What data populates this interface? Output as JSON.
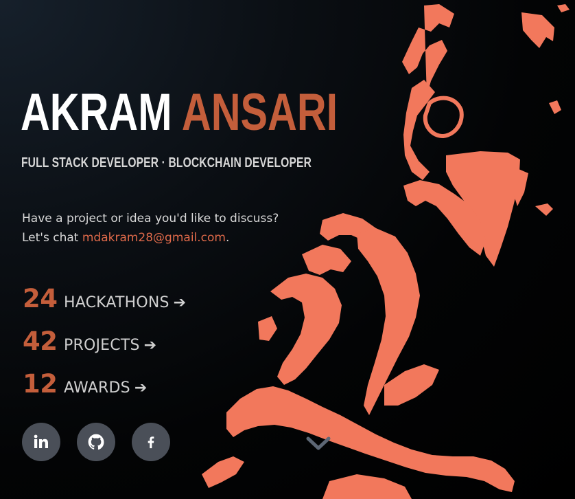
{
  "hero": {
    "first_name": "AKRAM",
    "last_name": "ANSARI",
    "subtitle": "FULL STACK DEVELOPER · BLOCKCHAIN DEVELOPER"
  },
  "contact": {
    "line1": "Have a project or idea you'd like to discuss?",
    "line2_prefix": "Let's chat ",
    "email": "mdakram28@gmail.com",
    "line2_suffix": "."
  },
  "stats": [
    {
      "number": "24",
      "label": "HACKATHONS"
    },
    {
      "number": "42",
      "label": "PROJECTS"
    },
    {
      "number": "12",
      "label": "AWARDS"
    }
  ],
  "socials": [
    {
      "name": "linkedin",
      "icon": "linkedin-icon"
    },
    {
      "name": "github",
      "icon": "github-icon"
    },
    {
      "name": "facebook",
      "icon": "facebook-icon"
    }
  ],
  "icons": {
    "stat_arrow": "arrow-right-icon",
    "scroll": "chevron-down-icon"
  },
  "colors": {
    "accent": "#c45e3b",
    "portrait": "#f2785c",
    "social_bg": "#4a4f58",
    "chevron": "#5d6775"
  }
}
